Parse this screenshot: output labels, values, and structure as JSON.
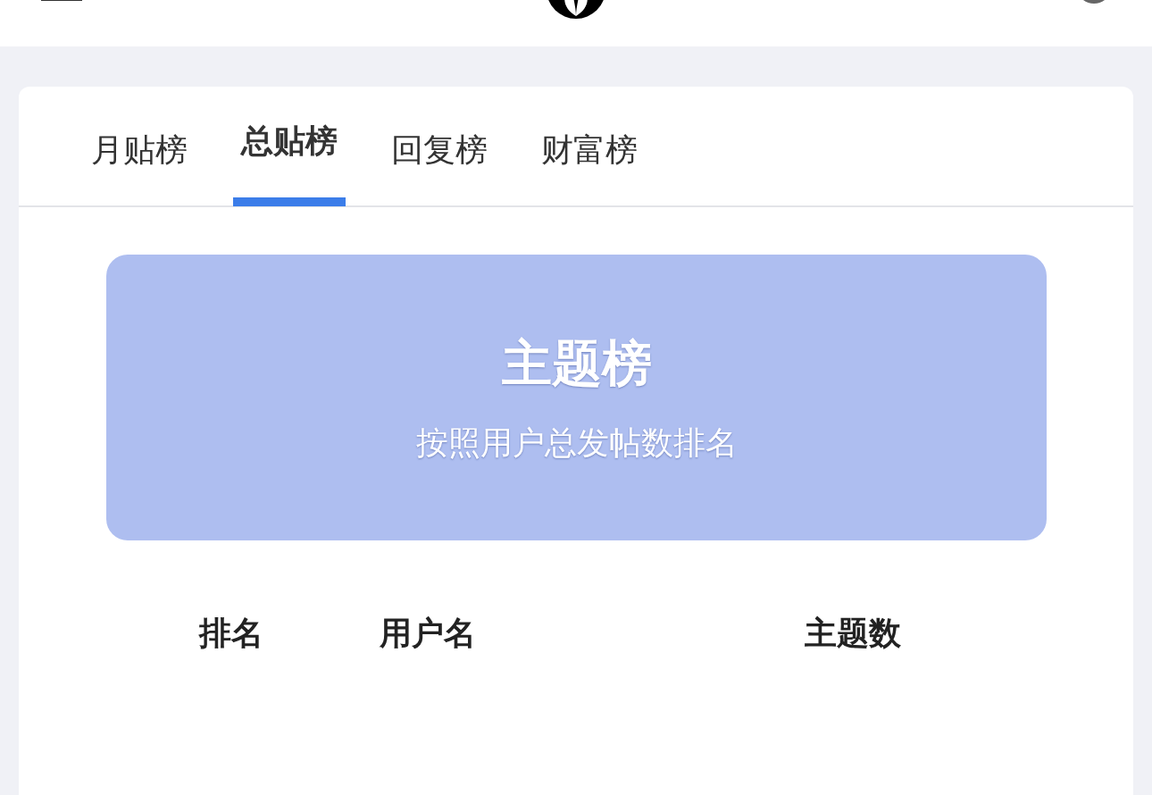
{
  "tabs": [
    {
      "label": "月贴榜",
      "selected": false
    },
    {
      "label": "总贴榜",
      "selected": true
    },
    {
      "label": "回复榜",
      "selected": false
    },
    {
      "label": "财富榜",
      "selected": false
    }
  ],
  "banner": {
    "title": "主题榜",
    "subtitle": "按照用户总发帖数排名"
  },
  "table": {
    "columns": [
      "排名",
      "用户名",
      "主题数"
    ]
  }
}
